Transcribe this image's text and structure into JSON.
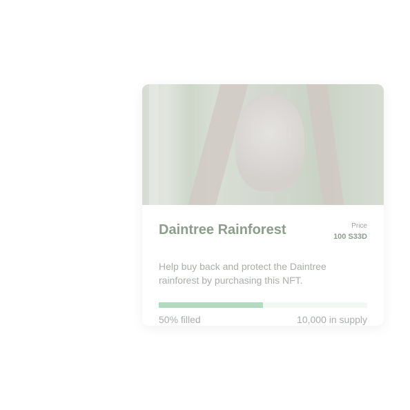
{
  "card": {
    "image_alt": "koala-in-tree-photo",
    "title": "Daintree Rainforest",
    "price_label": "Price",
    "price_value": "100 S33D",
    "description": "Help buy back and protect the Daintree rainforest by purchasing this NFT.",
    "progress_percent": 50,
    "filled_label": "50% filled",
    "supply_label": "10,000 in supply",
    "colors": {
      "accent": "#b2dbbf",
      "track": "#f3f8f4",
      "title": "#8b9e89"
    }
  }
}
